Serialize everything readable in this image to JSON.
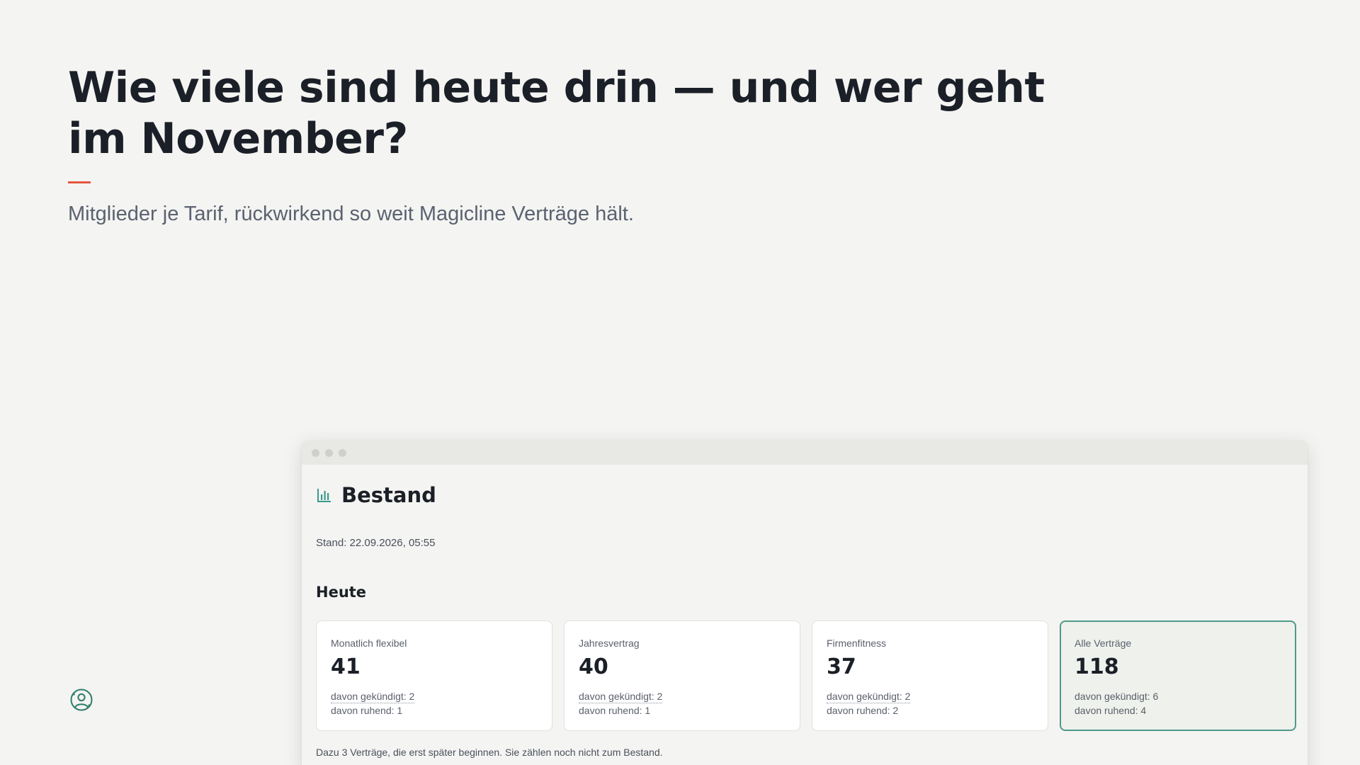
{
  "slide": {
    "headline": "Wie viele sind heute drin — und wer geht im November?",
    "subline": "Mitglieder je Tarif, rückwirkend so weit Magicline Verträge hält.",
    "accent_color": "#e2583e",
    "brand_icon": "person-circle-icon"
  },
  "window": {
    "title": "Bestand",
    "title_icon": "bar-chart-icon",
    "stand": "Stand: 22.09.2026, 05:55",
    "section_title": "Heute",
    "cards": [
      {
        "label": "Monatlich flexibel",
        "value": "41",
        "gekuendigt": "davon gekündigt: 2",
        "ruhend": "davon ruhend: 1"
      },
      {
        "label": "Jahresvertrag",
        "value": "40",
        "gekuendigt": "davon gekündigt: 2",
        "ruhend": "davon ruhend: 1"
      },
      {
        "label": "Firmenfitness",
        "value": "37",
        "gekuendigt": "davon gekündigt: 2",
        "ruhend": "davon ruhend: 2"
      },
      {
        "label": "Alle Verträge",
        "value": "118",
        "gekuendigt": "davon gekündigt: 6",
        "ruhend": "davon ruhend: 4"
      }
    ],
    "footnote": "Dazu 3 Verträge, die erst später beginnen. Sie zählen noch nicht zum Bestand.",
    "highlight_color": "#4e9a8a"
  }
}
